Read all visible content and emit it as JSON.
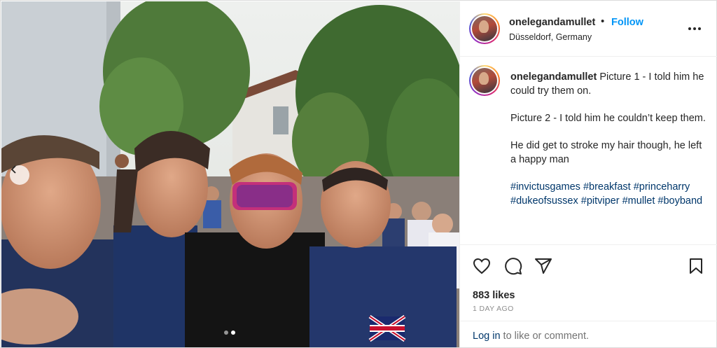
{
  "post": {
    "username": "onelegandamullet",
    "separator": "•",
    "follow_label": "Follow",
    "location": "Düsseldorf, Germany",
    "caption": {
      "username": "onelegandamullet",
      "line1": "Picture 1 - I told him he could try them on.",
      "line2": "Picture 2 - I told him he couldn’t keep them.",
      "line3": "He did get to stroke my hair though, he left a happy man",
      "hashtags": [
        "#invictusgames",
        "#breakfast",
        "#princeharry",
        "#dukeofsussex",
        "#pitviper",
        "#mullet",
        "#boyband"
      ]
    },
    "likes": "883 likes",
    "time": "1 DAY AGO",
    "login_link": "Log in",
    "login_suffix": " to like or comment."
  },
  "media": {
    "total_slides": 2,
    "active_slide": 2,
    "description_icons": {
      "prev": "chevron-left-icon",
      "more": "more-options-icon",
      "like": "heart-icon",
      "comment": "comment-icon",
      "share": "share-icon",
      "save": "bookmark-icon"
    }
  },
  "colors": {
    "follow": "#0095f6",
    "hashtag": "#00376b",
    "text": "#262626",
    "muted": "#8e8e8e"
  }
}
